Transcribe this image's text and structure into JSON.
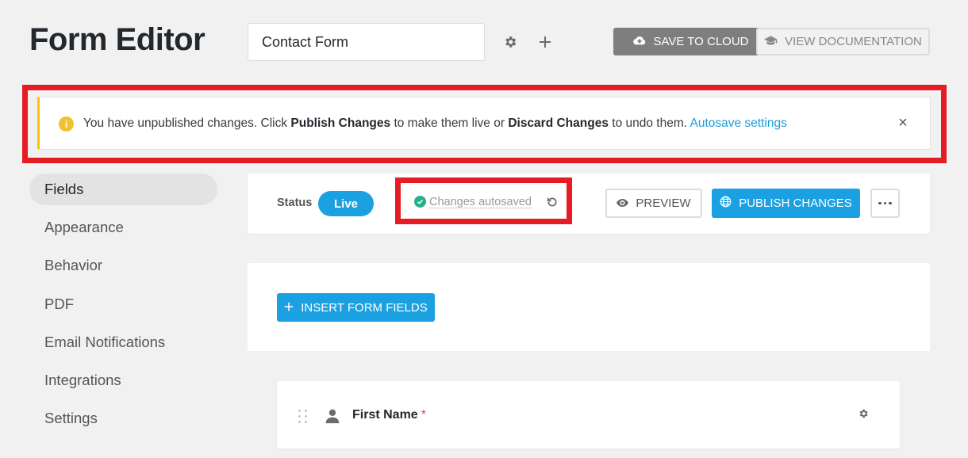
{
  "header": {
    "title": "Form Editor",
    "form_name": "Contact Form",
    "save_to_cloud": "SAVE TO CLOUD",
    "view_documentation": "VIEW DOCUMENTATION"
  },
  "notice": {
    "part1": "You have unpublished changes. Click ",
    "publish": "Publish Changes",
    "part2": " to make them live or ",
    "discard": "Discard Changes",
    "part3": " to undo them. ",
    "link": "Autosave settings",
    "close": "×",
    "accent_color": "#ffc107"
  },
  "sidebar": {
    "items": [
      {
        "label": "Fields",
        "active": true
      },
      {
        "label": "Appearance"
      },
      {
        "label": "Behavior"
      },
      {
        "label": "PDF"
      },
      {
        "label": "Email Notifications"
      },
      {
        "label": "Integrations"
      },
      {
        "label": "Settings"
      }
    ]
  },
  "toolbar": {
    "status_label": "Status",
    "status_value": "Live",
    "autosave_text": "Changes autosaved",
    "preview": "PREVIEW",
    "publish": "PUBLISH CHANGES"
  },
  "content": {
    "insert_button": "INSERT FORM FIELDS",
    "field": {
      "label": "First Name",
      "required_mark": "*"
    }
  },
  "colors": {
    "primary": "#1ba1e2",
    "highlight": "#e61c24",
    "success": "#25b28a",
    "grey_button": "#7e7e7e"
  },
  "icons": {
    "gear": "gear-icon",
    "plus": "plus-icon",
    "cloud": "cloud-upload-icon",
    "docs": "graduation-cap-icon",
    "info": "info-icon",
    "close": "close-icon",
    "check": "check-circle-icon",
    "undo": "undo-icon",
    "eye": "eye-icon",
    "globe": "globe-icon",
    "more": "more-horizontal-icon",
    "drag": "drag-handle-icon",
    "person": "person-icon"
  }
}
